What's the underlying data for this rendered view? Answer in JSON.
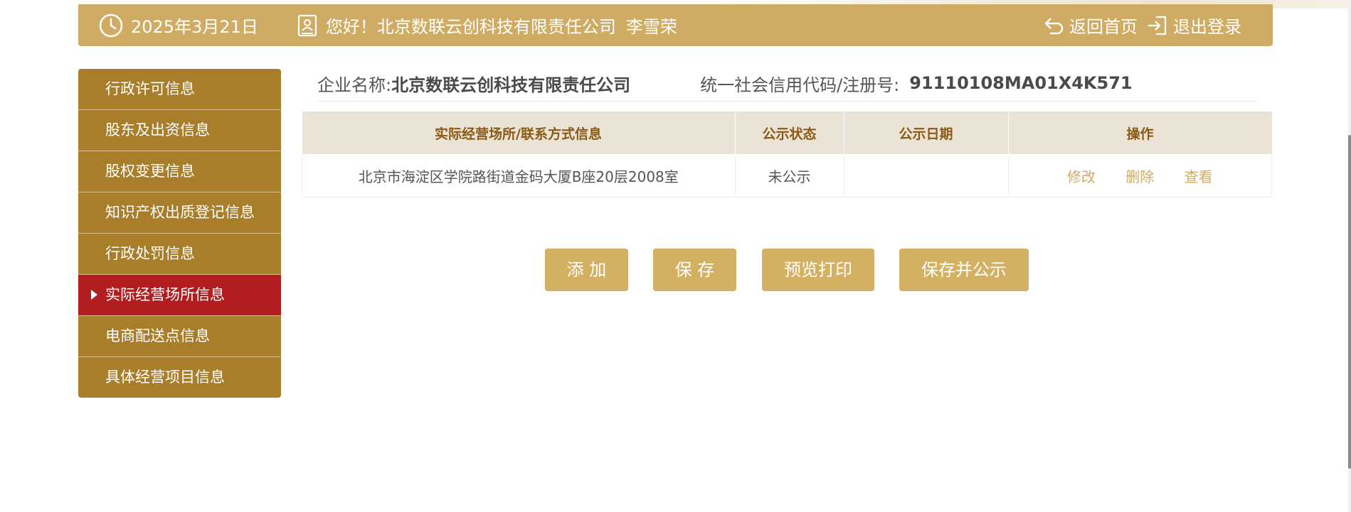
{
  "header": {
    "date": "2025年3月21日",
    "greeting": "您好！北京数联云创科技有限责任公司",
    "user": "李雪荣",
    "home_label": "返回首页",
    "logout_label": "退出登录"
  },
  "sidebar": {
    "items": [
      {
        "label": "行政许可信息"
      },
      {
        "label": "股东及出资信息"
      },
      {
        "label": "股权变更信息"
      },
      {
        "label": "知识产权出质登记信息"
      },
      {
        "label": "行政处罚信息"
      },
      {
        "label": "实际经营场所信息",
        "active": true
      },
      {
        "label": "电商配送点信息"
      },
      {
        "label": "具体经营项目信息"
      }
    ]
  },
  "company": {
    "name_label": "企业名称:",
    "name": "北京数联云创科技有限责任公司",
    "credit_label": "统一社会信用代码/注册号:",
    "credit_code": "91110108MA01X4K571"
  },
  "table": {
    "headers": [
      "实际经营场所/联系方式信息",
      "公示状态",
      "公示日期",
      "操作"
    ],
    "rows": [
      {
        "address": "北京市海淀区学院路街道金码大厦B座20层2008室",
        "status": "未公示",
        "date": "",
        "ops": [
          "修改",
          "删除",
          "查看"
        ]
      }
    ]
  },
  "buttons": {
    "add": "添 加",
    "save": "保 存",
    "preview": "预览打印",
    "save_publish": "保存并公示"
  },
  "colors": {
    "gold": "#d0ab63",
    "sidebar_brown": "#a87e2b",
    "active_red": "#b21d1f"
  }
}
